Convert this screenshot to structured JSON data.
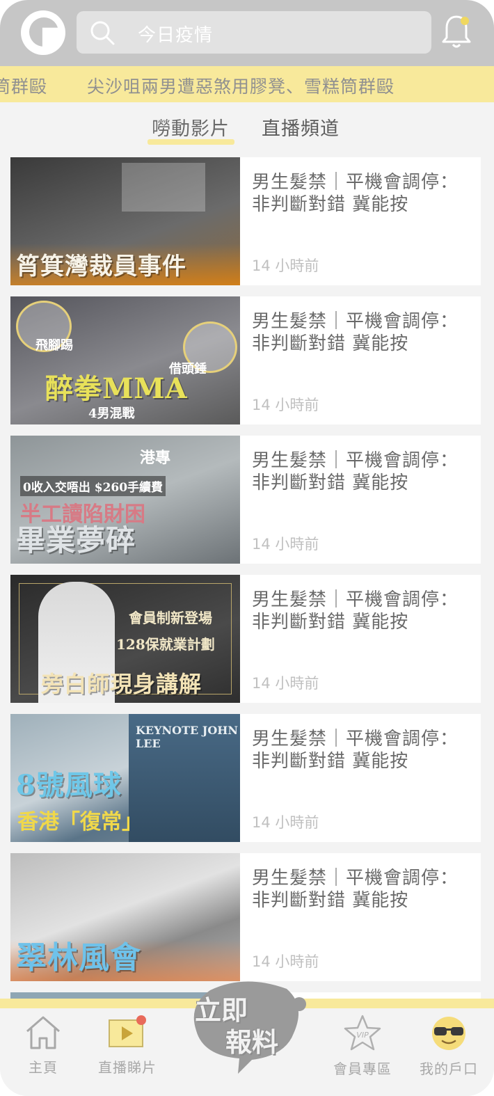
{
  "header": {
    "search_query": "今日疫情"
  },
  "ticker": {
    "fragment": "筒群毆",
    "headline": "尖沙咀兩男遭惡煞用膠凳、雪糕筒群毆"
  },
  "tabs": [
    {
      "label": "嘮動影片",
      "active": true
    },
    {
      "label": "直播頻道",
      "active": false
    }
  ],
  "videos": [
    {
      "title": "男生髮禁｜平機會調停：非判斷對錯 冀能按",
      "time": "14 小時前",
      "thumb_caption": "筲箕灣裁員事件",
      "thumb_colors": [
        "#3a3a3a",
        "#6b6b6b"
      ]
    },
    {
      "title": "男生髮禁｜平機會調停：非判斷對錯 冀能按",
      "time": "14 小時前",
      "thumb_caption": "醉拳MMA",
      "thumb_sub": [
        "飛腳踢",
        "借頭錘",
        "4男混戰"
      ],
      "thumb_colors": [
        "#4d4d55",
        "#8a8a8f"
      ]
    },
    {
      "title": "男生髮禁｜平機會調停：非判斷對錯 冀能按",
      "time": "14 小時前",
      "thumb_caption": "畢業夢碎",
      "thumb_sub": [
        "0收入交唔出 $260手續費",
        "半工讀陷財困",
        "港專"
      ],
      "thumb_colors": [
        "#6c7276",
        "#a9b0b2"
      ]
    },
    {
      "title": "男生髮禁｜平機會調停：非判斷對錯 冀能按",
      "time": "14 小時前",
      "thumb_caption": "旁白師現身講解",
      "thumb_sub": [
        "會員制新登場",
        "128保就業計劃"
      ],
      "thumb_colors": [
        "#2e2e2e",
        "#5a5a5a"
      ]
    },
    {
      "title": "男生髮禁｜平機會調停：非判斷對錯 冀能按",
      "time": "14 小時前",
      "thumb_caption": "8號風球",
      "thumb_sub": [
        "香港「復常」",
        "KEYNOTE JOHN LEE"
      ],
      "thumb_colors": [
        "#7d8f9a",
        "#c8d2d8"
      ]
    },
    {
      "title": "男生髮禁｜平機會調停：非判斷對錯 冀能按",
      "time": "14 小時前",
      "thumb_caption": "翠林風會",
      "thumb_colors": [
        "#8a8a8a",
        "#c9c9c9"
      ]
    }
  ],
  "bottom_nav": {
    "home": "主頁",
    "live": "直播睇片",
    "report_line1": "立即",
    "report_line2": "報料",
    "vip": "會員專區",
    "vip_badge": "VIP",
    "account": "我的戶口"
  },
  "colors": {
    "accent_yellow": "#f8e99b",
    "header_gray": "#c6c6c6",
    "notification_dot": "#f0d860",
    "live_dot": "#e86a5a"
  }
}
